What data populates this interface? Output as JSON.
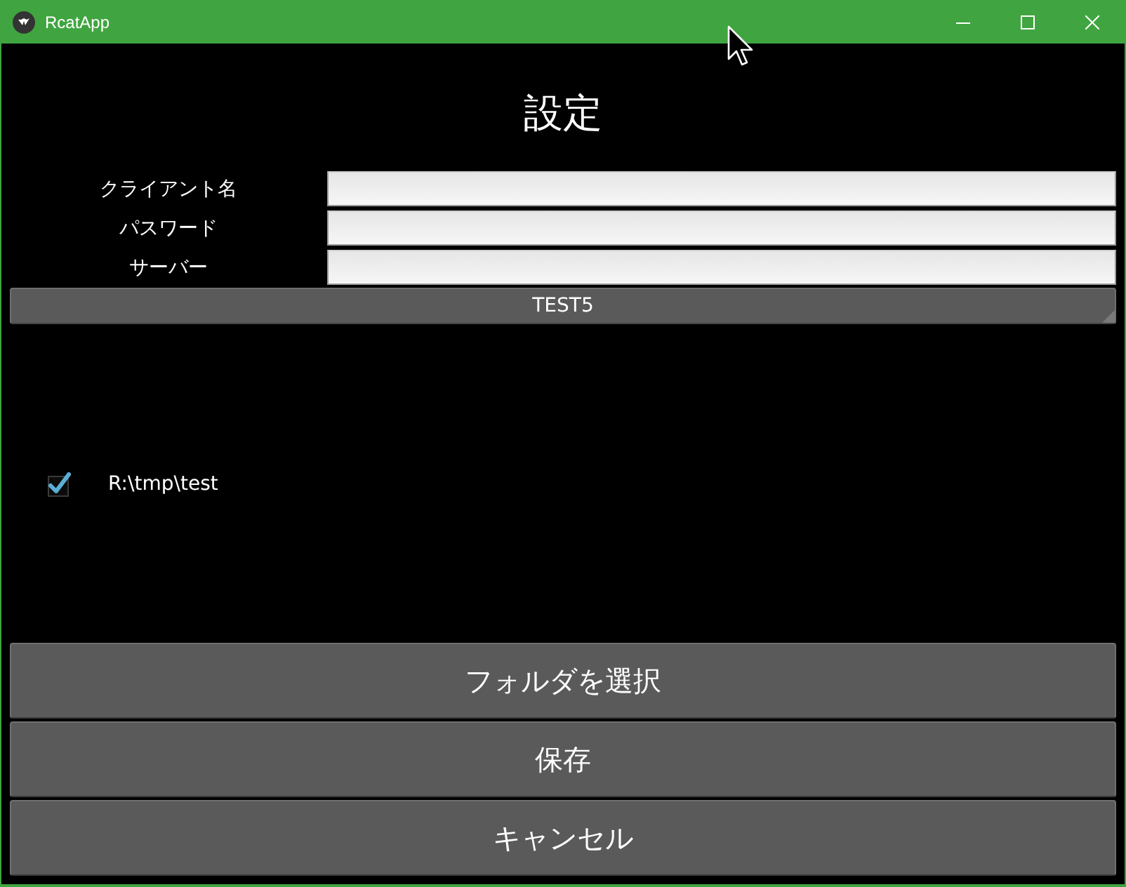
{
  "window": {
    "title": "RcatApp"
  },
  "heading": "設定",
  "fields": [
    {
      "label": "クライアント名"
    },
    {
      "label": "パスワード"
    },
    {
      "label": "サーバー"
    }
  ],
  "spinner": {
    "value": "TEST5"
  },
  "folders": [
    {
      "path": "R:\\tmp\\test",
      "checked": true
    }
  ],
  "buttons": [
    "フォルダを選択",
    "保存",
    "キャンセル"
  ]
}
